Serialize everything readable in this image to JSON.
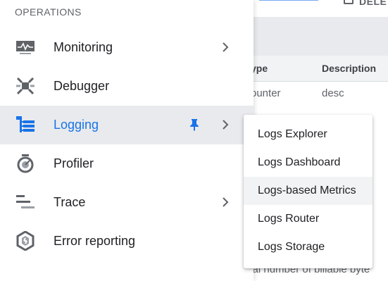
{
  "background": {
    "topbar_partial_text": "DELE",
    "table": {
      "headers": [
        "ype",
        "Description"
      ],
      "row": [
        "ounter",
        "desc"
      ]
    },
    "bottom_text": "otal number of billable byte"
  },
  "operations_menu": {
    "section_header": "OPERATIONS",
    "items": [
      {
        "label": "Monitoring",
        "icon": "monitoring-icon",
        "has_submenu": true
      },
      {
        "label": "Debugger",
        "icon": "debugger-icon",
        "has_submenu": false
      },
      {
        "label": "Logging",
        "icon": "logging-icon",
        "has_submenu": true,
        "active": true,
        "pinned": true
      },
      {
        "label": "Profiler",
        "icon": "profiler-icon",
        "has_submenu": false
      },
      {
        "label": "Trace",
        "icon": "trace-icon",
        "has_submenu": true
      },
      {
        "label": "Error reporting",
        "icon": "error-reporting-icon",
        "has_submenu": false
      }
    ]
  },
  "logging_submenu": {
    "items": [
      {
        "label": "Logs Explorer"
      },
      {
        "label": "Logs Dashboard"
      },
      {
        "label": "Logs-based Metrics",
        "hovered": true
      },
      {
        "label": "Logs Router"
      },
      {
        "label": "Logs Storage"
      }
    ]
  },
  "colors": {
    "accent": "#1a73e8",
    "active_bg": "#e8eaed",
    "icon_gray": "#5f6368",
    "text": "#202124"
  }
}
